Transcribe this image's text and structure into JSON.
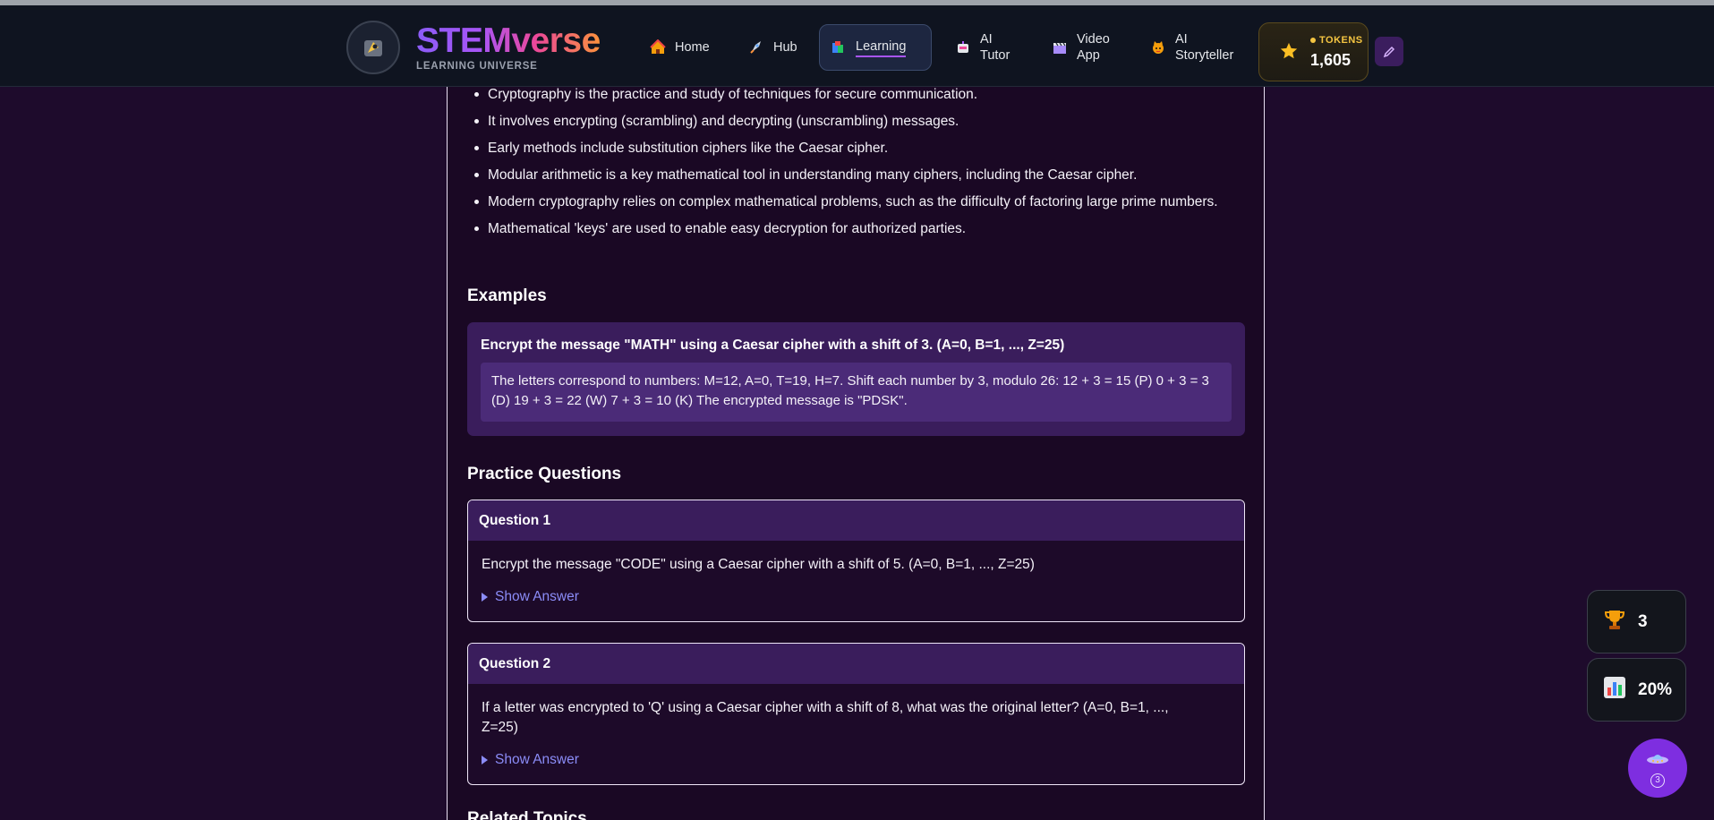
{
  "brand": {
    "title": "STEMverse",
    "subtitle": "LEARNING UNIVERSE"
  },
  "nav": [
    {
      "label": "Home",
      "icon": "house-icon"
    },
    {
      "label": "Hub",
      "icon": "rocket-icon"
    },
    {
      "label": "Learning",
      "icon": "books-icon",
      "active": true
    },
    {
      "label": "AI Tutor",
      "icon": "robot-icon"
    },
    {
      "label": "Video App",
      "icon": "clapperboard-icon"
    },
    {
      "label": "AI Storyteller",
      "icon": "cat-icon"
    }
  ],
  "tokens": {
    "label": "TOKENS",
    "value": "1,605"
  },
  "content": {
    "bullets": [
      "Cryptography is the practice and study of techniques for secure communication.",
      "It involves encrypting (scrambling) and decrypting (unscrambling) messages.",
      "Early methods include substitution ciphers like the Caesar cipher.",
      "Modular arithmetic is a key mathematical tool in understanding many ciphers, including the Caesar cipher.",
      "Modern cryptography relies on complex mathematical problems, such as the difficulty of factoring large prime numbers.",
      "Mathematical 'keys' are used to enable easy decryption for authorized parties."
    ],
    "examples_title": "Examples",
    "example": {
      "question": "Encrypt the message \"MATH\" using a Caesar cipher with a shift of 3. (A=0, B=1, ..., Z=25)",
      "answer": "The letters correspond to numbers: M=12, A=0, T=19, H=7. Shift each number by 3, modulo 26: 12 + 3 = 15 (P) 0 + 3 = 3 (D) 19 + 3 = 22 (W) 7 + 3 = 10 (K) The encrypted message is \"PDSK\"."
    },
    "practice_title": "Practice Questions",
    "questions": [
      {
        "title": "Question 1",
        "text": "Encrypt the message \"CODE\" using a Caesar cipher with a shift of 5. (A=0, B=1, ..., Z=25)",
        "show_answer": "Show Answer"
      },
      {
        "title": "Question 2",
        "text": "If a letter was encrypted to 'Q' using a Caesar cipher with a shift of 8, what was the original letter? (A=0, B=1, ..., Z=25)",
        "show_answer": "Show Answer"
      }
    ],
    "related_title": "Related Topics"
  },
  "widgets": {
    "trophy_count": "3",
    "progress_percent": "20%",
    "fab_badge": "3"
  },
  "colors": {
    "background": "#1e0b2c",
    "header": "#0f1420",
    "accent_purple": "#7e2ee0",
    "link": "#8b8cf7",
    "token_gold": "#f5c542"
  }
}
